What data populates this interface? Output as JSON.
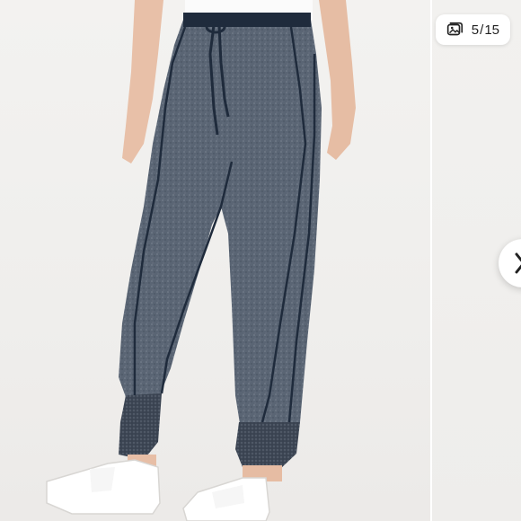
{
  "viewer": {
    "current_index": "5",
    "separator": "/",
    "total_count": "15",
    "icons": {
      "counter": "image-gallery-icon",
      "next": "chevron-right-icon"
    },
    "colors": {
      "pants": "#56616f",
      "piping": "#1f2b3c",
      "cuff": "#3e4756",
      "background": "#f1f0ee",
      "sneakers": "#ffffff",
      "skin": "#e9c2aa"
    }
  }
}
